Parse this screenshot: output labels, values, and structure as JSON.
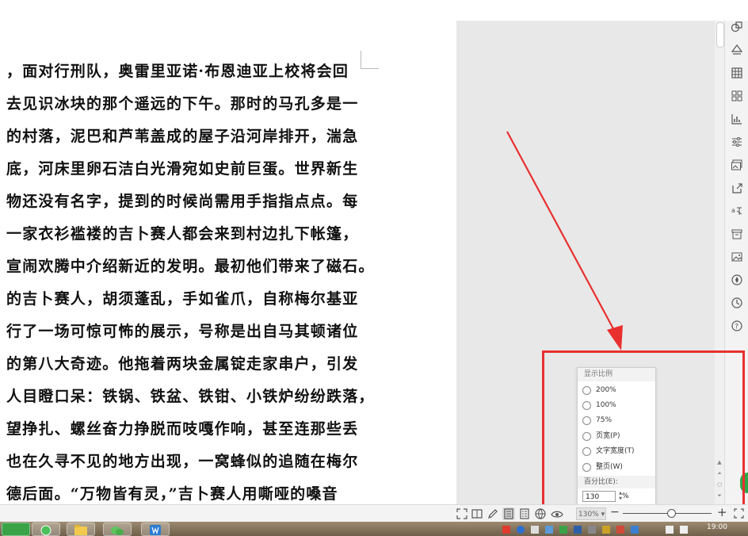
{
  "document": {
    "lines": [
      "，面对行刑队，奥雷里亚诺·布恩迪亚上校将会回",
      "去见识冰块的那个遥远的下午。那时的马孔多是一",
      "的村落，泥巴和芦苇盖成的屋子沿河岸排开，湍急",
      "底，河床里卵石洁白光滑宛如史前巨蛋。世界新生",
      "物还没有名字，提到的时候尚需用手指指点点。每",
      "一家衣衫褴褛的吉卜赛人都会来到村边扎下帐篷，",
      "宣闹欢腾中介绍新近的发明。最初他们带来了磁石。",
      "的吉卜赛人，胡须蓬乱，手如雀爪，自称梅尔基亚",
      "行了一场可惊可怖的展示，号称是出自马其顿诸位",
      "的第八大奇迹。他拖着两块金属锭走家串户，引发",
      "人目瞪口呆：铁锅、铁盆、铁钳、小铁炉纷纷跌落，",
      "望挣扎、螺丝奋力挣脱而吱嘎作响，甚至连那些丢",
      "也在久寻不见的地方出现，一窝蜂似的追随在梅尔",
      "德后面。“万物皆有灵，”吉卜赛人用嘶哑的嗓音"
    ]
  },
  "zoom_popup": {
    "title": "显示比例",
    "options": [
      "200%",
      "100%",
      "75%",
      "页宽(P)",
      "文字宽度(T)",
      "整页(W)"
    ],
    "percent_label": "百分比(E):",
    "percent_value": "130",
    "percent_unit": "%"
  },
  "status_bar": {
    "zoom_value": "130%",
    "zoom_minus": "−",
    "zoom_plus": "+",
    "zoom_level_percent": 130
  },
  "taskbar": {
    "clock": "19:00"
  },
  "colors": {
    "highlight": "#e8302f",
    "workspace": "#e8e8e8"
  }
}
